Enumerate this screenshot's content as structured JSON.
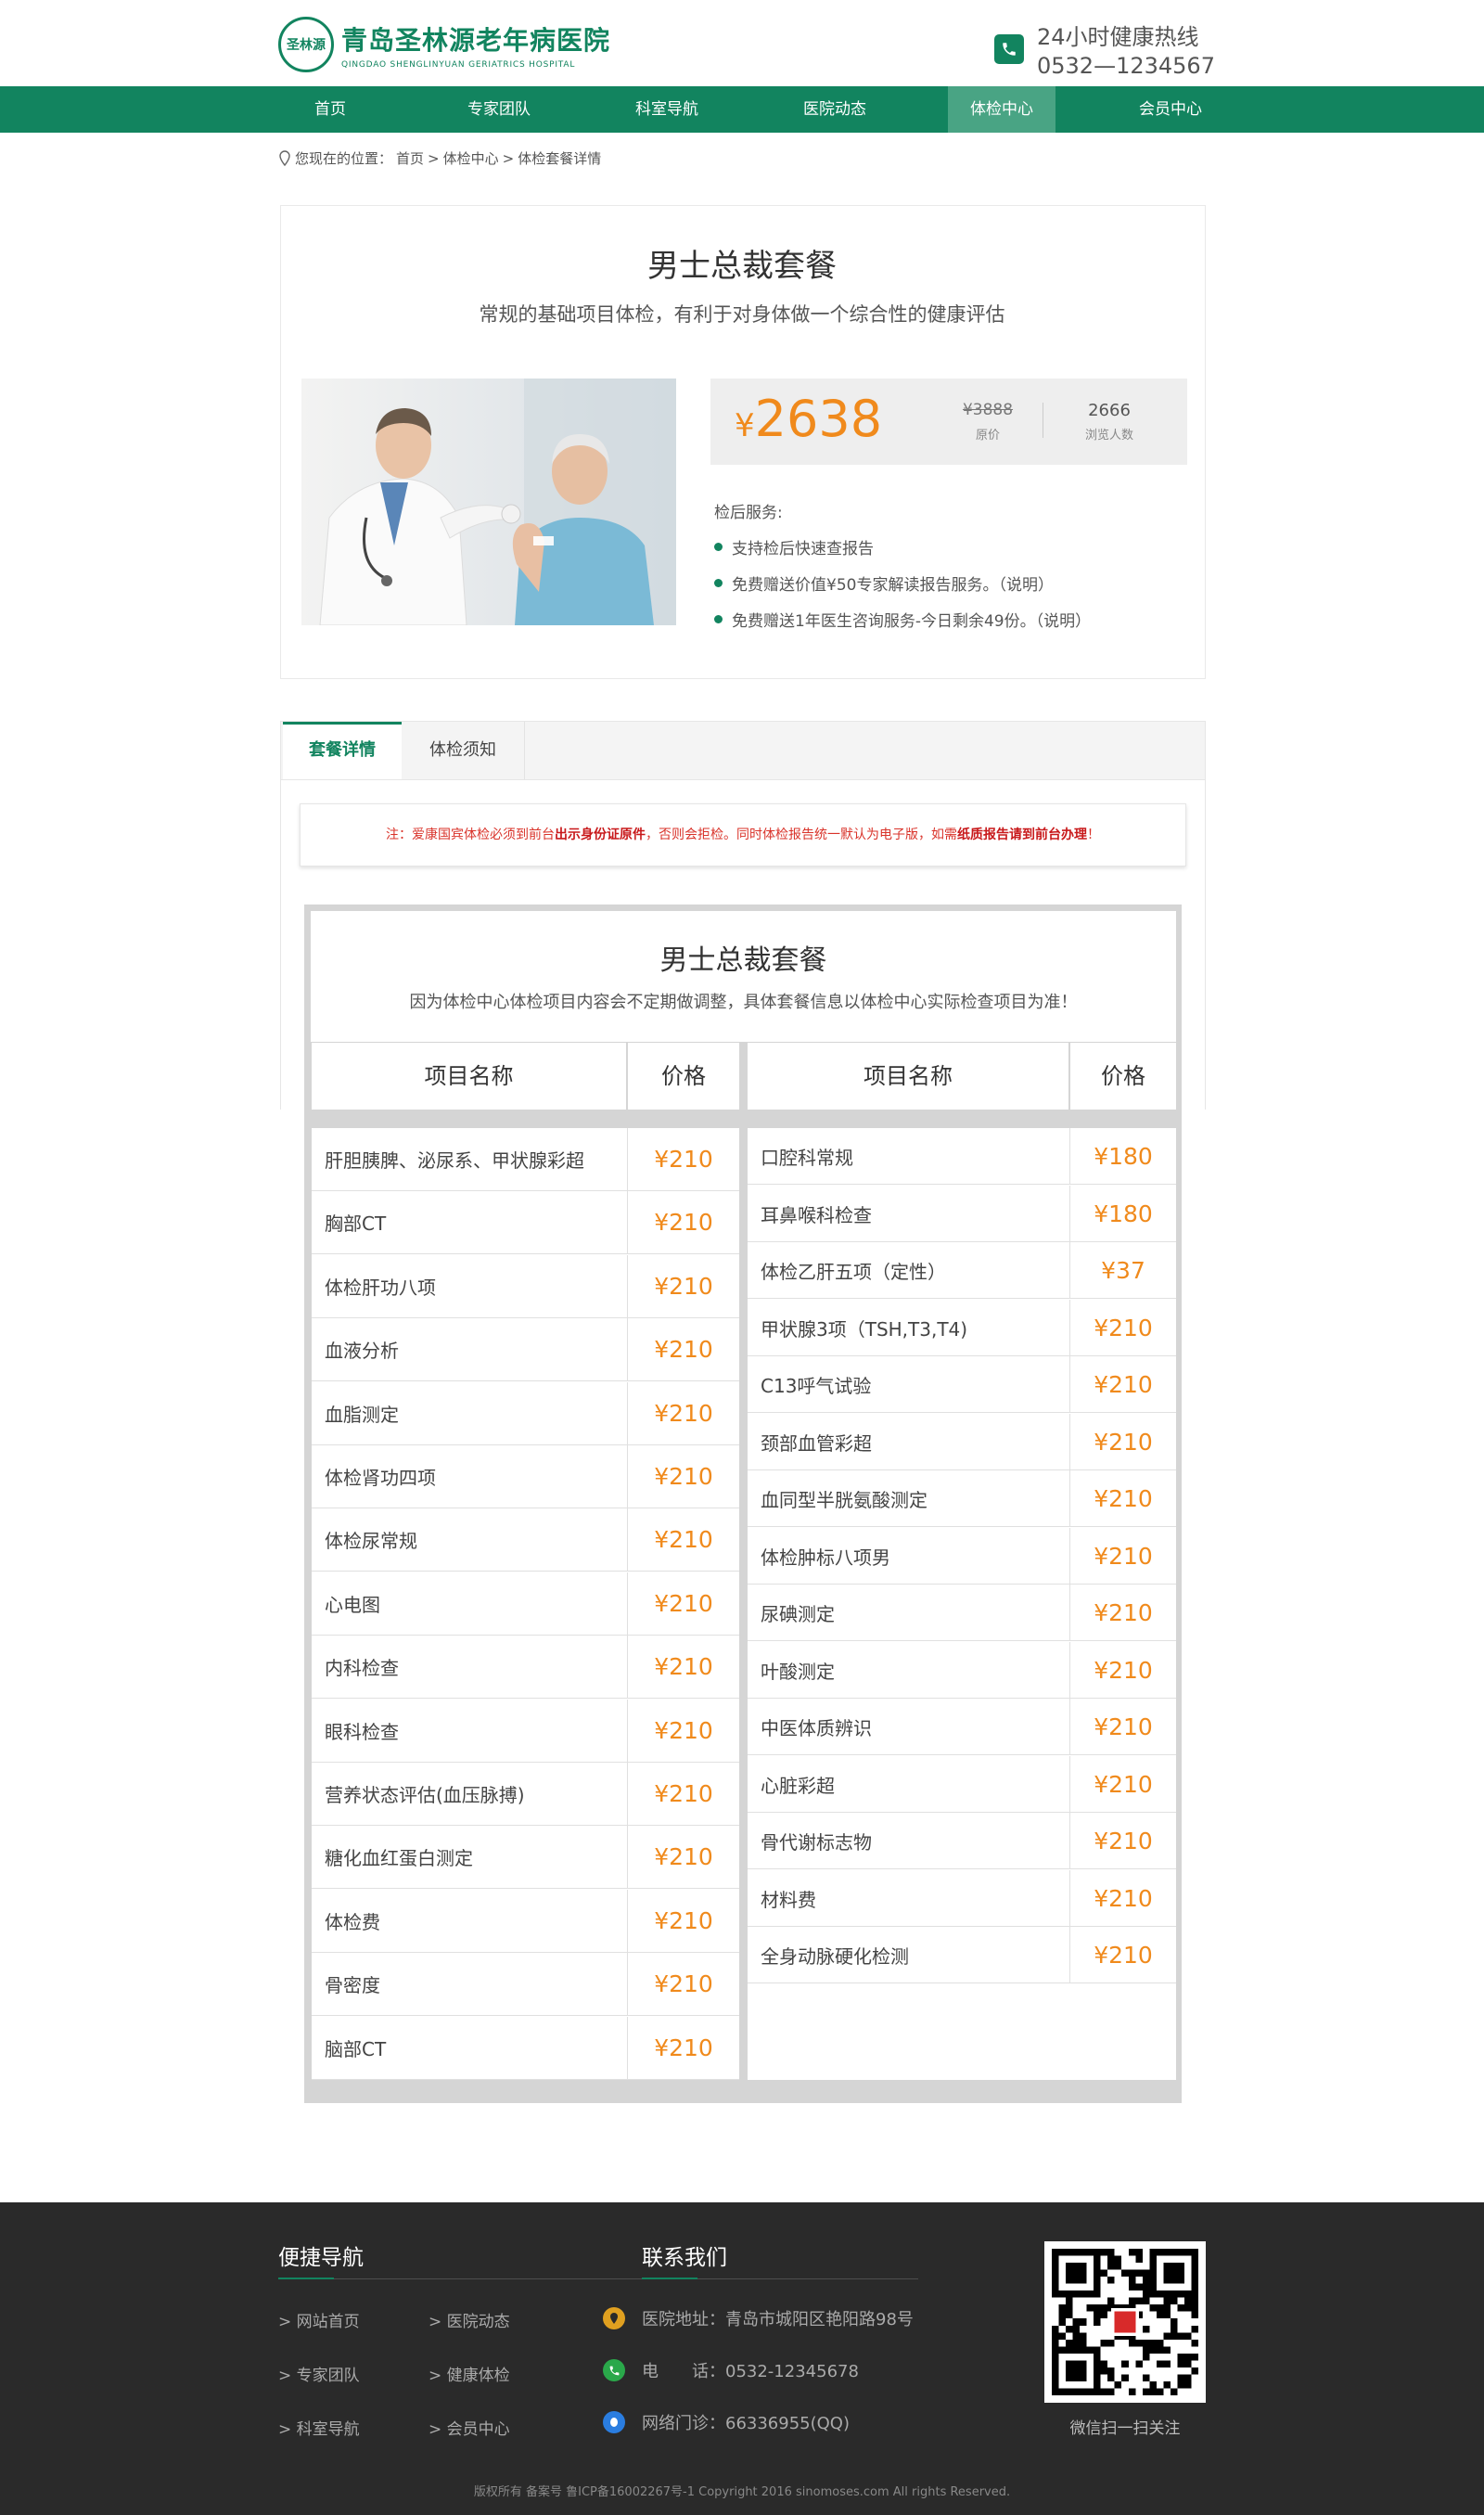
{
  "header": {
    "logo_badge": "圣林源",
    "logo_cn": "青岛圣林源老年病医院",
    "logo_en": "QINGDAO SHENGLINYUAN GERIATRICS HOSPITAL",
    "hotline_title": "24小时健康热线",
    "hotline_number": "0532—1234567"
  },
  "nav": {
    "items": [
      "首页",
      "专家团队",
      "科室导航",
      "医院动态",
      "体检中心",
      "会员中心"
    ],
    "active": "体检中心"
  },
  "breadcrumb": {
    "prefix": "您现在的位置：",
    "crumbs": [
      "首页",
      "体检中心",
      "体检套餐详情"
    ],
    "separator": ">"
  },
  "package": {
    "title": "男士总裁套餐",
    "subtitle": "常规的基础项目体检，有利于对身体做一个综合性的健康评估",
    "price": "2638",
    "currency": "¥",
    "original_price": "¥3888",
    "original_label": "原价",
    "views": "2666",
    "views_label": "浏览人数",
    "services_title": "检后服务:",
    "services": [
      "支持检后快速查报告",
      "免费赠送价值¥50专家解读报告服务。（说明）",
      "免费赠送1年医生咨询服务-今日剩余49份。（说明）"
    ]
  },
  "tabs": [
    "套餐详情",
    "体检须知"
  ],
  "notice": {
    "p1": "注：爱康国宾体检必须到前台",
    "b1": "出示身份证原件",
    "p2": "，否则会拒检。同时体检报告统一默认为电子版，如需",
    "b2": "纸质报告请到前台办理",
    "p3": "！"
  },
  "table": {
    "title": "男士总裁套餐",
    "note": "因为体检中心体检项目内容会不定期做调整，具体套餐信息以体检中心实际检查项目为准！",
    "header_name": "项目名称",
    "header_price": "价格",
    "left": [
      {
        "name": "肝胆胰脾、泌尿系、甲状腺彩超",
        "price": "¥210"
      },
      {
        "name": "胸部CT",
        "price": "¥210"
      },
      {
        "name": "体检肝功八项",
        "price": "¥210"
      },
      {
        "name": "血液分析",
        "price": "¥210"
      },
      {
        "name": "血脂测定",
        "price": "¥210"
      },
      {
        "name": "体检肾功四项",
        "price": "¥210"
      },
      {
        "name": "体检尿常规",
        "price": "¥210"
      },
      {
        "name": "心电图",
        "price": "¥210"
      },
      {
        "name": "内科检查",
        "price": "¥210"
      },
      {
        "name": "眼科检查",
        "price": "¥210"
      },
      {
        "name": "营养状态评估(血压脉搏)",
        "price": "¥210"
      },
      {
        "name": "糖化血红蛋白测定",
        "price": "¥210"
      },
      {
        "name": "体检费",
        "price": "¥210"
      },
      {
        "name": "骨密度",
        "price": "¥210"
      },
      {
        "name": "脑部CT",
        "price": "¥210"
      }
    ],
    "right": [
      {
        "name": "口腔科常规",
        "price": "¥180"
      },
      {
        "name": "耳鼻喉科检查",
        "price": "¥180"
      },
      {
        "name": "体检乙肝五项（定性）",
        "price": "¥37"
      },
      {
        "name": "甲状腺3项（TSH,T3,T4)",
        "price": "¥210"
      },
      {
        "name": "C13呼气试验",
        "price": "¥210"
      },
      {
        "name": "颈部血管彩超",
        "price": "¥210"
      },
      {
        "name": "血同型半胱氨酸测定",
        "price": "¥210"
      },
      {
        "name": "体检肿标八项男",
        "price": "¥210"
      },
      {
        "name": "尿碘测定",
        "price": "¥210"
      },
      {
        "name": "叶酸测定",
        "price": "¥210"
      },
      {
        "name": "中医体质辨识",
        "price": "¥210"
      },
      {
        "name": "心脏彩超",
        "price": "¥210"
      },
      {
        "name": "骨代谢标志物",
        "price": "¥210"
      },
      {
        "name": "材料费",
        "price": "¥210"
      },
      {
        "name": "全身动脉硬化检测",
        "price": "¥210"
      }
    ]
  },
  "footer": {
    "nav_title": "便捷导航",
    "contact_title": "联系我们",
    "links": [
      "网站首页",
      "医院动态",
      "专家团队",
      "健康体检",
      "科室导航",
      "会员中心"
    ],
    "link_prefix": ">",
    "address": "医院地址：青岛市城阳区艳阳路98号",
    "phone": "电　　话：0532-12345678",
    "qq": "网络门诊：66336955(QQ)",
    "qr_label": "微信扫一扫关注",
    "copyright": "版权所有 备案号 鲁ICP备16002267号-1 Copyright 2016 sinomoses.com All rights Reserved."
  },
  "colors": {
    "brand": "#12845f",
    "nav_active": "#49a484",
    "price": "#f08a1c",
    "notice": "#d9332a",
    "footer_bg": "#2a2a2a"
  }
}
